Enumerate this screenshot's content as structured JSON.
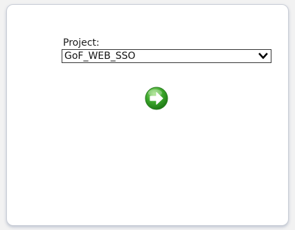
{
  "form": {
    "project_label": "Project:",
    "project_selected": "GoF_WEB_SSO"
  },
  "icons": {
    "dropdown": "chevron-down-icon",
    "submit": "green-arrow-right-icon"
  },
  "colors": {
    "go_button_green": "#3aa52a",
    "panel_border": "#c9cdd6"
  }
}
